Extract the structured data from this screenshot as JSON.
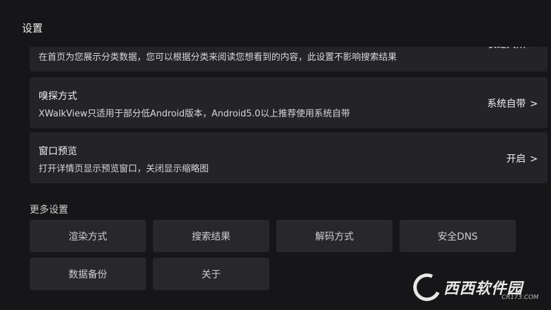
{
  "header": {
    "title": "设置"
  },
  "settings": {
    "home": {
      "description": "在首页为您展示分类数据，您可以根据分类来阅读您想看到的内容，此设置不影响搜索结果",
      "value": "长虹大众"
    },
    "sniff": {
      "title": "嗅探方式",
      "description": "XWalkView只适用于部分低Android版本，Android5.0以上推荐使用系统自带",
      "value": "系统自带"
    },
    "preview": {
      "title": "窗口预览",
      "description": "打开详情页显示预览窗口，关闭显示缩略图",
      "value": "开启"
    },
    "chevron": ">"
  },
  "more": {
    "title": "更多设置",
    "items": [
      "渲染方式",
      "搜索结果",
      "解码方式",
      "安全DNS",
      "数据备份",
      "关于"
    ]
  },
  "watermark": {
    "text": "西西软件园",
    "sub": "CR173.COM"
  },
  "icons": {
    "chevron": "chevron-right-icon",
    "logo": "watermark-logo-icon"
  }
}
